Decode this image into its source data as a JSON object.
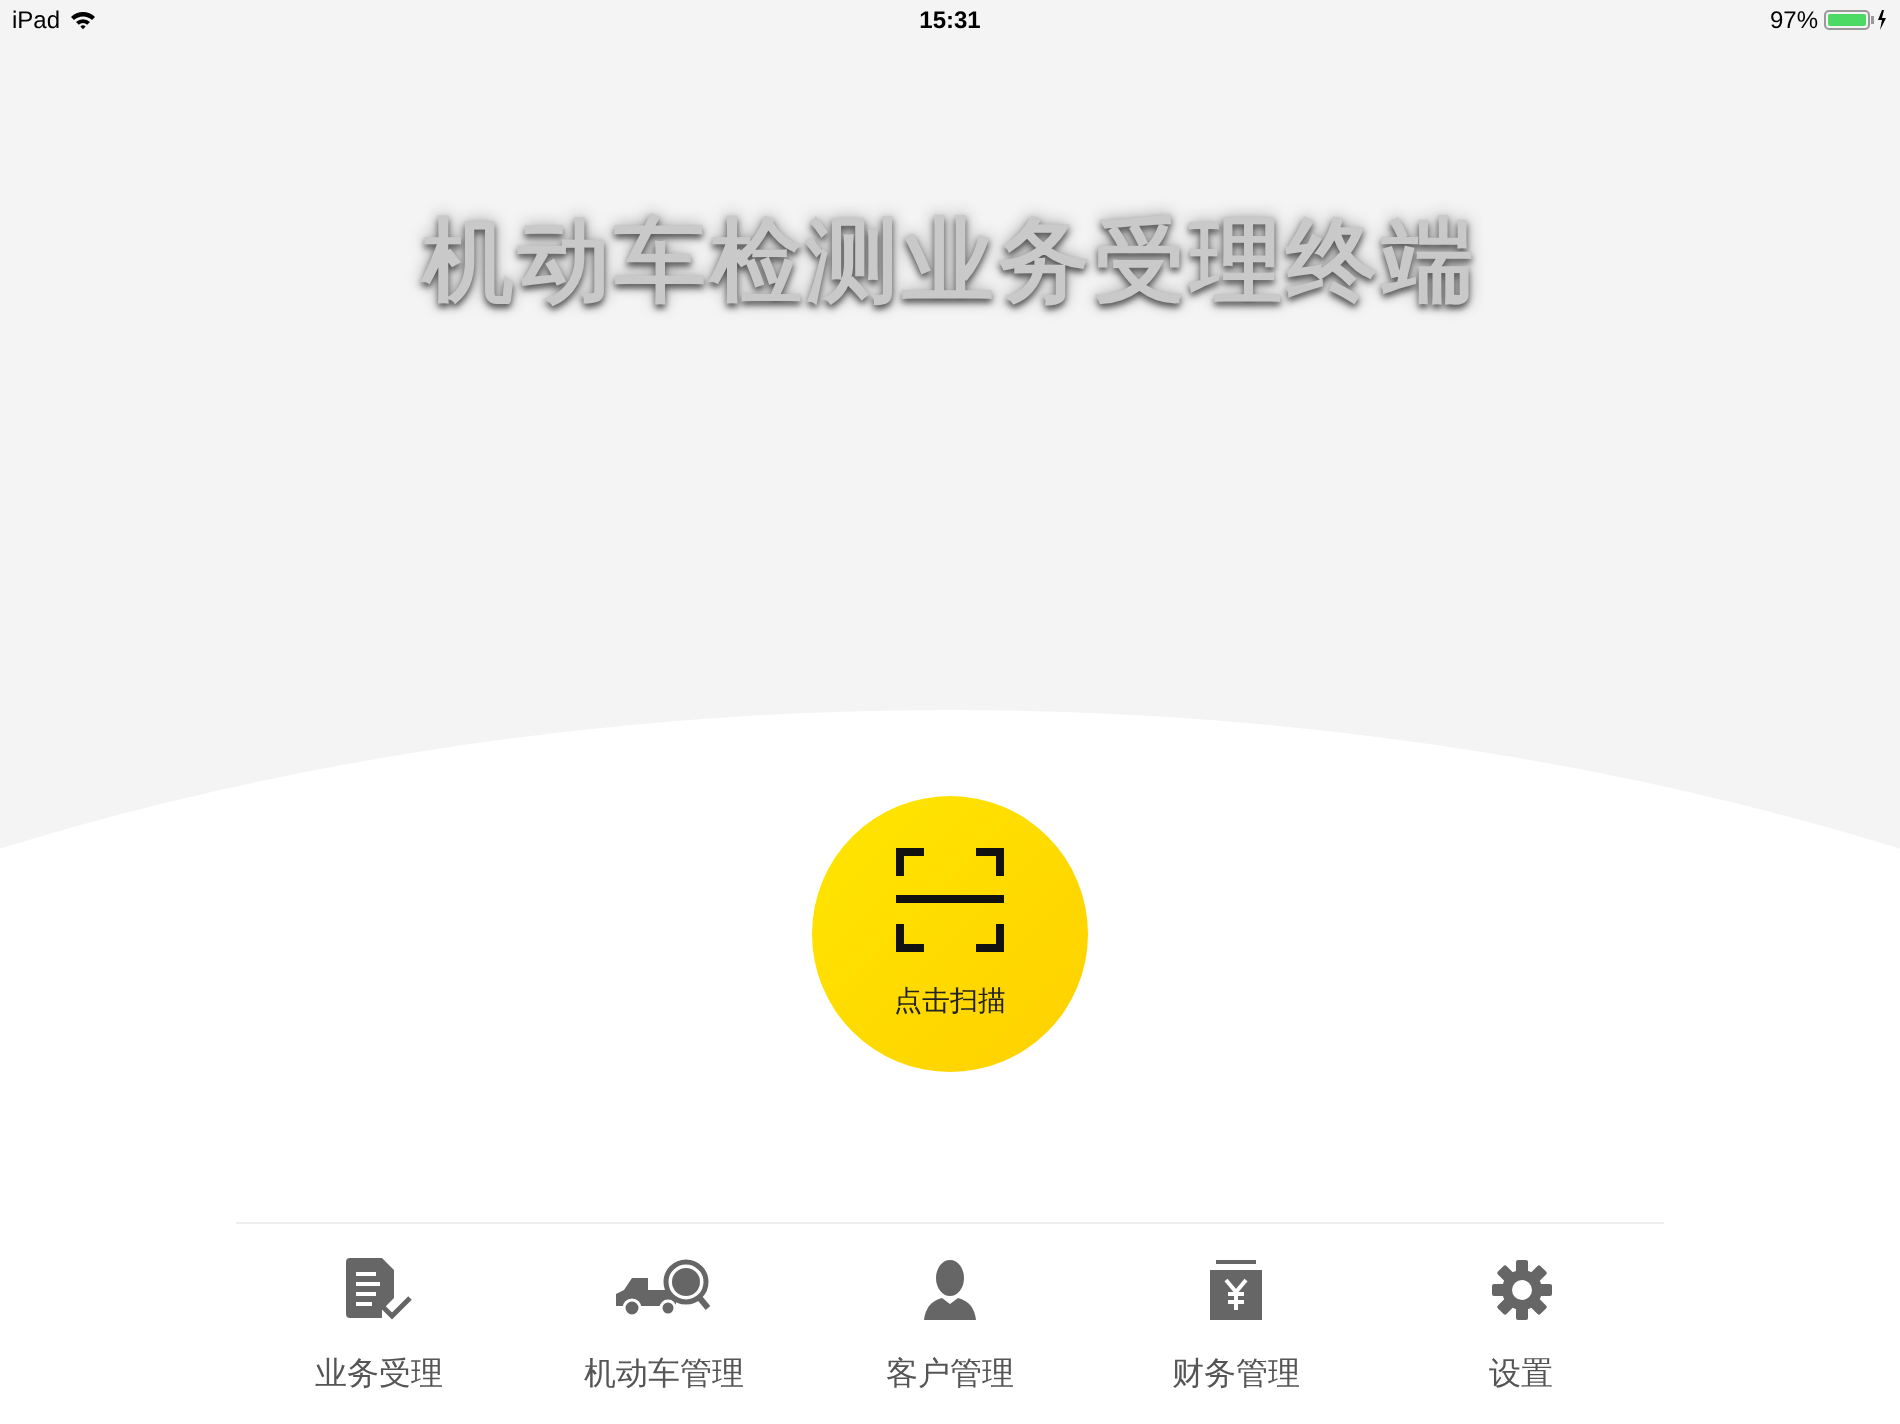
{
  "status_bar": {
    "device": "iPad",
    "time": "15:31",
    "battery": "97%"
  },
  "title": "机动车检测业务受理终端",
  "scan_button": {
    "label": "点击扫描"
  },
  "tab_bar": [
    {
      "label": "业务受理",
      "kind": "document"
    },
    {
      "label": "机动车管理",
      "kind": "vehicle"
    },
    {
      "label": "客户管理",
      "kind": "person"
    },
    {
      "label": "财务管理",
      "kind": "finance"
    },
    {
      "label": "设置",
      "kind": "settings"
    }
  ]
}
